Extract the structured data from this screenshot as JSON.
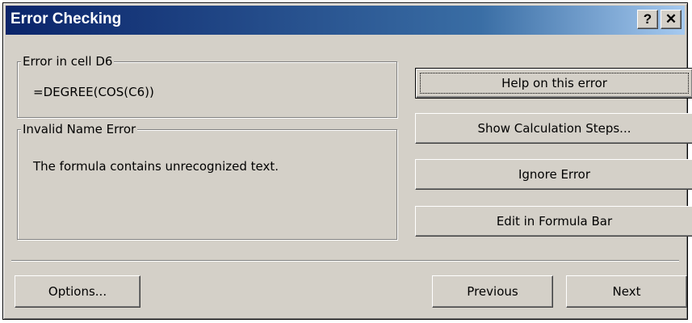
{
  "window": {
    "title": "Error Checking",
    "help_button": "?",
    "close_button": "✕"
  },
  "error_cell_group": {
    "legend": "Error in cell D6",
    "formula": "=DEGREE(COS(C6))"
  },
  "error_type_group": {
    "legend": "Invalid Name Error",
    "description": "The formula contains unrecognized text."
  },
  "buttons": {
    "help_on_error": "Help on this error",
    "show_calculation_steps": "Show Calculation Steps...",
    "ignore_error": "Ignore Error",
    "edit_in_formula_bar": "Edit in Formula Bar",
    "options": "Options...",
    "previous": "Previous",
    "next": "Next"
  }
}
